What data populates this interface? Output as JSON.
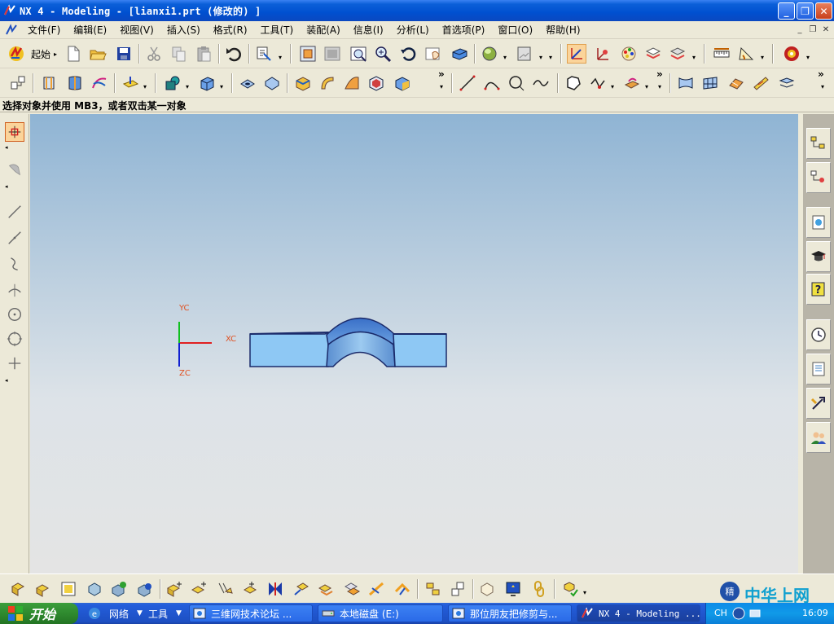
{
  "window": {
    "title": "NX 4 - Modeling - [lianxi1.prt  (修改的) ]",
    "minimize_glyph": "_",
    "restore_glyph": "❐",
    "close_glyph": "✕"
  },
  "menubar": {
    "items": [
      "文件(F)",
      "编辑(E)",
      "视图(V)",
      "插入(S)",
      "格式(R)",
      "工具(T)",
      "装配(A)",
      "信息(I)",
      "分析(L)",
      "首选项(P)",
      "窗口(O)",
      "帮助(H)"
    ],
    "mdi_buttons": [
      "_",
      "❐",
      "✕"
    ]
  },
  "toolbar1": {
    "start_label": "起始",
    "overflow": "»"
  },
  "toolbar2": {
    "overflow1": "»",
    "overflow2": "»"
  },
  "prompt": {
    "text": "选择对象并使用 MB3，或者双击某一对象"
  },
  "csys": {
    "yc": "YC",
    "xc": "XC",
    "zc": "ZC"
  },
  "taskbar": {
    "start_label": "开始",
    "quicklinks": [
      "网络",
      "工具"
    ],
    "tasks": [
      {
        "label": "三维网技术论坛 ..."
      },
      {
        "label": "本地磁盘 (E:)"
      },
      {
        "label": "那位朋友把修剪与..."
      },
      {
        "label": "NX 4 - Modeling ..."
      }
    ],
    "tray": {
      "lang": "CH",
      "clock": "16:09",
      "watermark": "中华上网"
    }
  },
  "colors": {
    "titlebar": "#0a5fd8",
    "part_face": "#8ec8f4",
    "part_edge": "#1a2a6a",
    "axis_x": "#e02020",
    "axis_y": "#10c020",
    "axis_z": "#1020d0"
  }
}
